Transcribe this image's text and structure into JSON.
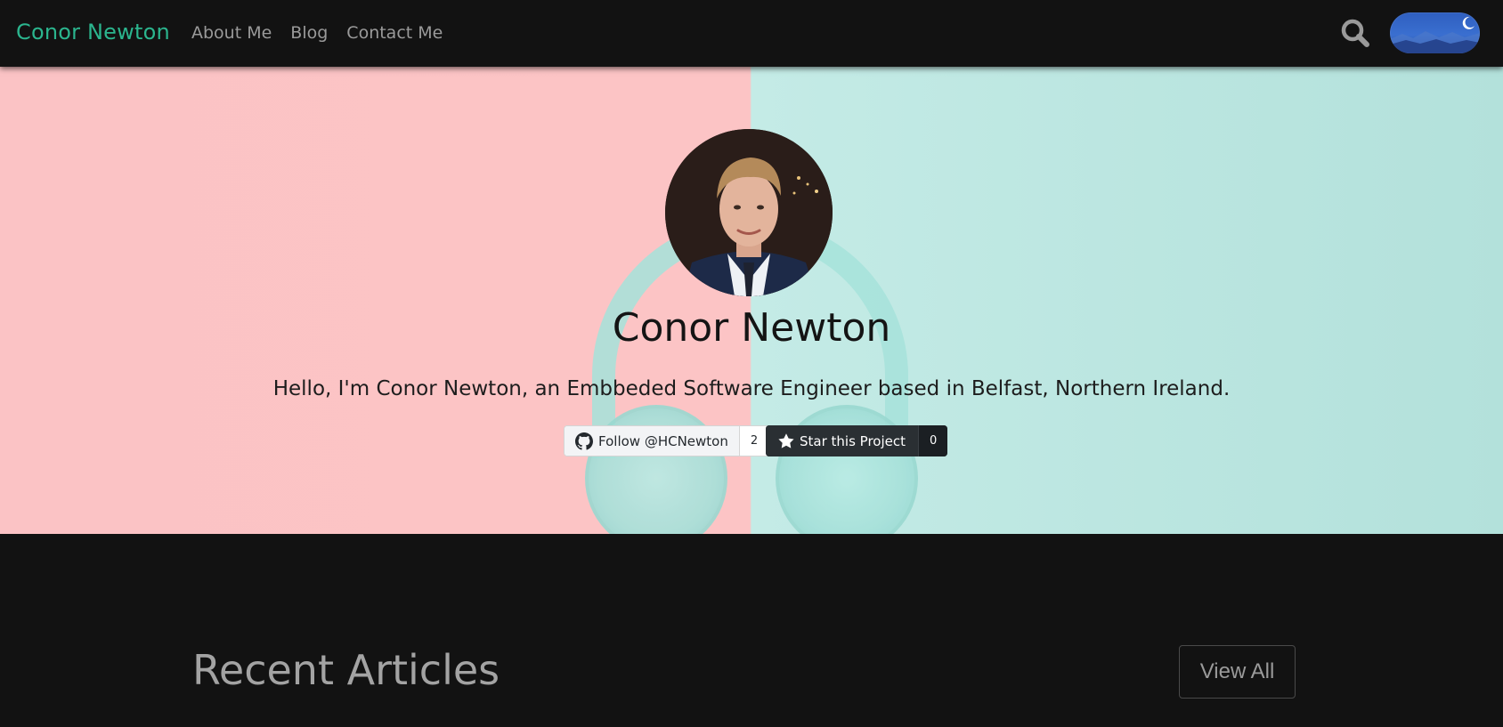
{
  "nav": {
    "brand": "Conor Newton",
    "links": [
      "About Me",
      "Blog",
      "Contact Me"
    ]
  },
  "icons": {
    "search": "search-icon",
    "theme_toggle": "moon-icon",
    "github": "github-icon",
    "star": "star-icon"
  },
  "colors": {
    "brand": "#2bb58e",
    "background": "#121212",
    "hero_left": "#fcc4c5",
    "hero_right": "#c4ebe6"
  },
  "hero": {
    "title": "Conor Newton",
    "subtitle": "Hello, I'm Conor Newton, an Embbeded Software Engineer based in Belfast, Northern Ireland.",
    "follow_button": {
      "label": "Follow @HCNewton",
      "count": "2"
    },
    "star_button": {
      "label": "Star this Project",
      "count": "0"
    }
  },
  "recent": {
    "title": "Recent Articles",
    "view_all": "View All"
  }
}
